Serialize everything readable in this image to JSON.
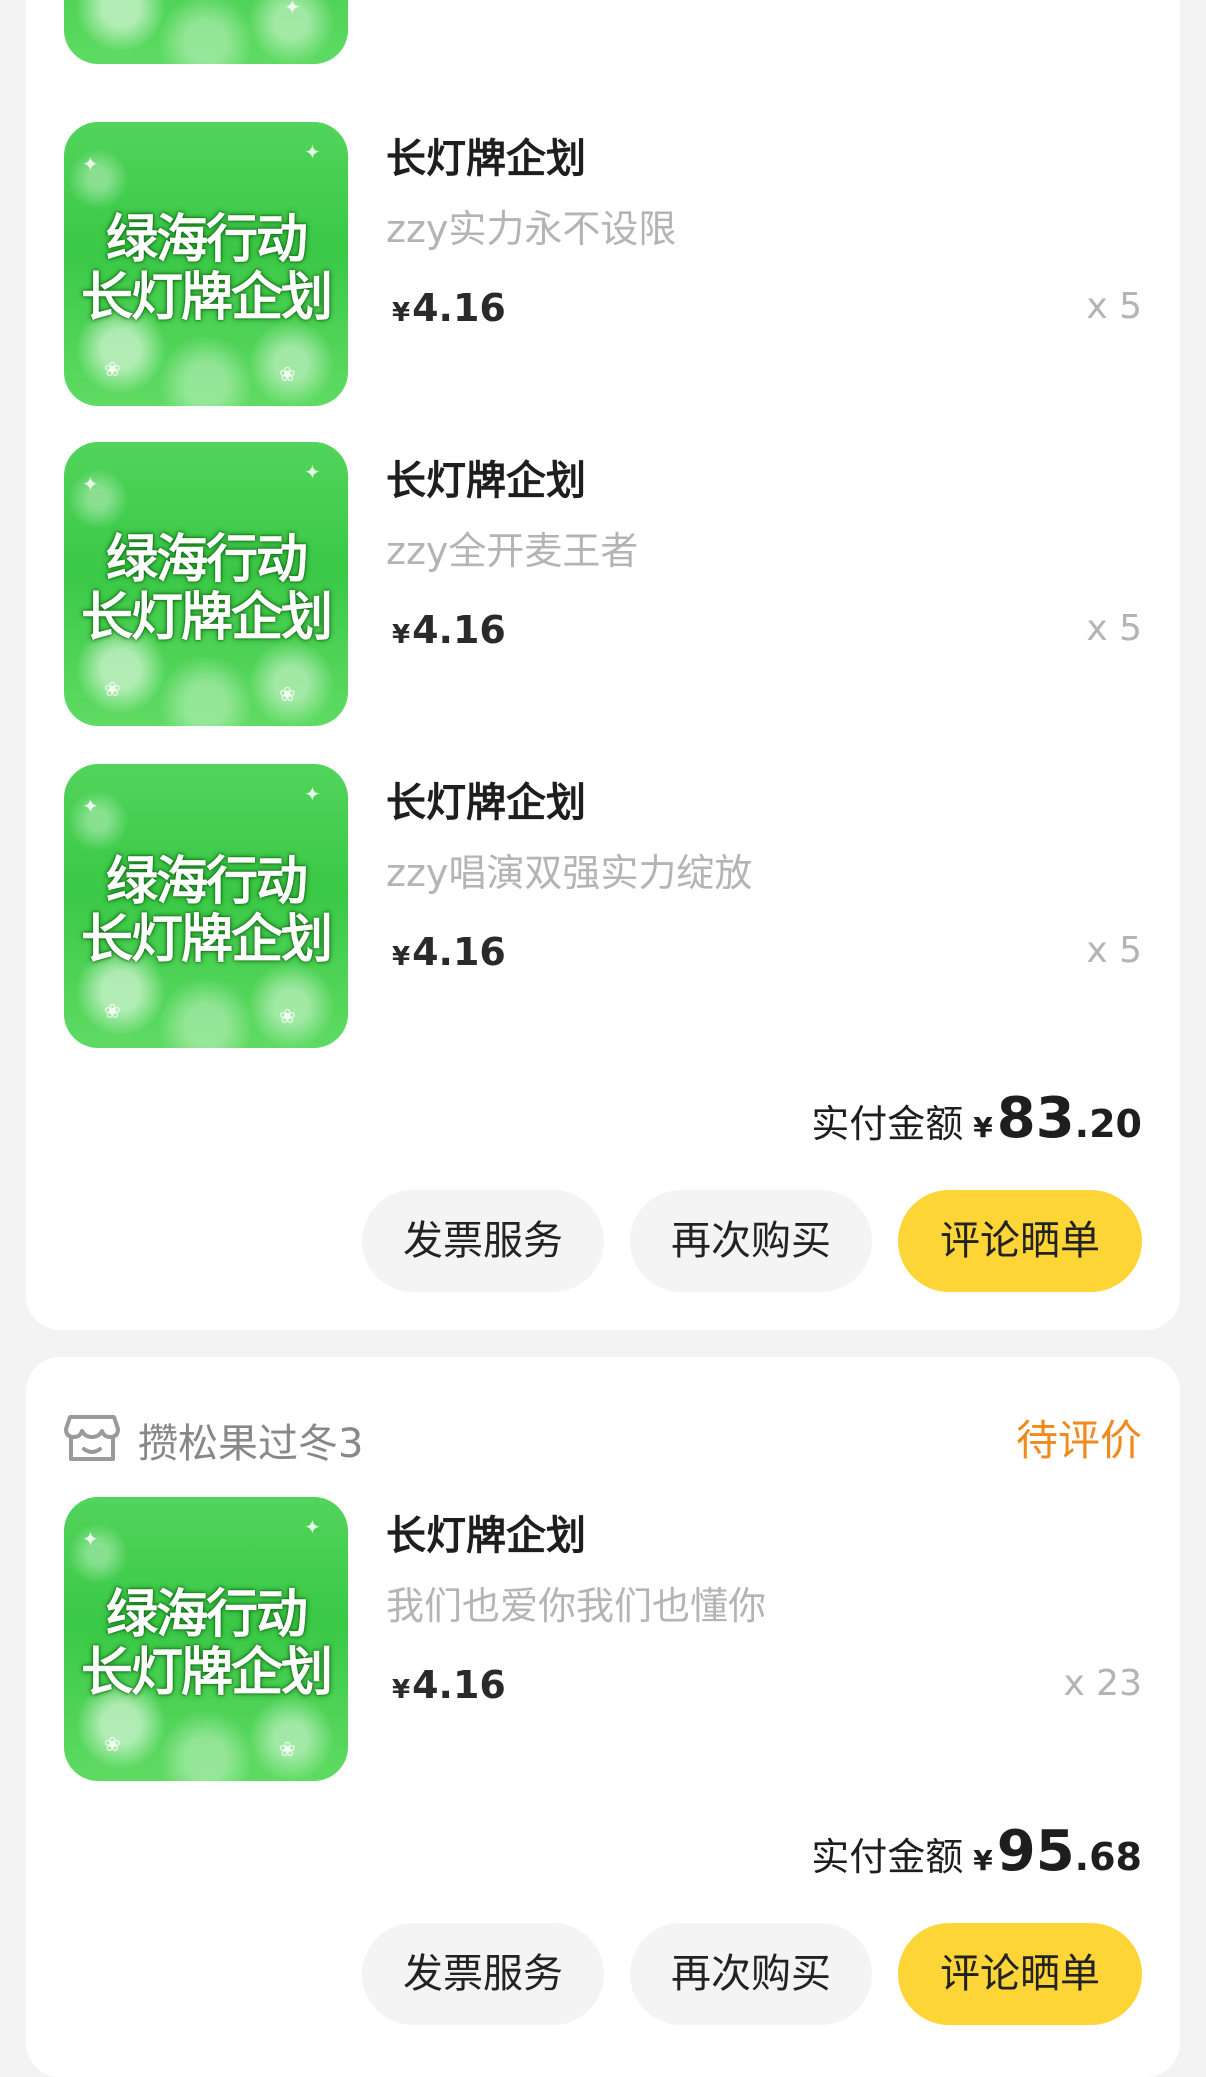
{
  "thumb_text": {
    "line1": "绿海行动",
    "line2": "长灯牌企划"
  },
  "order1": {
    "items": [
      {
        "title": "长灯牌企划",
        "subtitle": "zzy实力永不设限",
        "currency": "¥",
        "price": "4.16",
        "qty": "x 5"
      },
      {
        "title": "长灯牌企划",
        "subtitle": "zzy全开麦王者",
        "currency": "¥",
        "price": "4.16",
        "qty": "x 5"
      },
      {
        "title": "长灯牌企划",
        "subtitle": "zzy唱演双强实力绽放",
        "currency": "¥",
        "price": "4.16",
        "qty": "x 5"
      }
    ],
    "total": {
      "label": "实付金额",
      "currency": "¥",
      "integer": "83",
      "decimal": ".20"
    },
    "buttons": {
      "invoice": "发票服务",
      "rebuy": "再次购买",
      "review": "评论晒单"
    }
  },
  "order2": {
    "shop_name": "攒松果过冬3",
    "status": "待评价",
    "items": [
      {
        "title": "长灯牌企划",
        "subtitle": "我们也爱你我们也懂你",
        "currency": "¥",
        "price": "4.16",
        "qty": "x 23"
      }
    ],
    "total": {
      "label": "实付金额",
      "currency": "¥",
      "integer": "95",
      "decimal": ".68"
    },
    "buttons": {
      "invoice": "发票服务",
      "rebuy": "再次购买",
      "review": "评论晒单"
    }
  },
  "colors": {
    "accent_yellow": "#fed537",
    "status_orange": "#f08a1c",
    "thumb_green": "#3ac946",
    "page_background": "#f3f3f3"
  },
  "icons": {
    "shop": "shop-icon"
  }
}
